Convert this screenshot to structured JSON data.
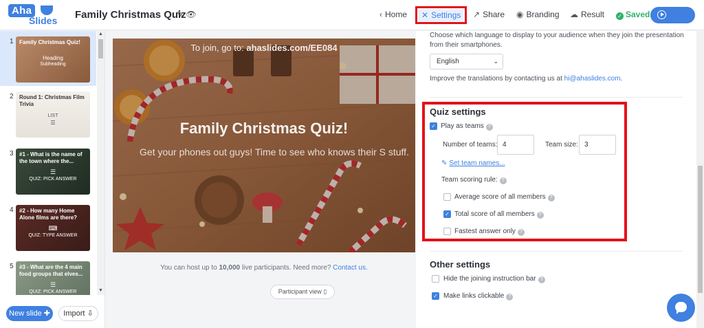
{
  "logo": {
    "top": "Aha",
    "bottom": "Slides"
  },
  "header": {
    "title": "Family Christmas Quiz"
  },
  "nav": {
    "home": "Home",
    "settings": "Settings",
    "share": "Share",
    "branding": "Branding",
    "result": "Result",
    "saved": "Saved",
    "present": "Present"
  },
  "slides": [
    {
      "num": "1",
      "title": "Family Christmas Quiz!",
      "heading": "Heading",
      "subheading": "Subheading"
    },
    {
      "num": "2",
      "title": "Round 1: Christmas Film Trivia",
      "kind": "LIST"
    },
    {
      "num": "3",
      "title": "#1 - What is the name of the town where the...",
      "kind": "QUIZ: PICK ANSWER"
    },
    {
      "num": "4",
      "title": "#2 - How many Home Alone films are there?",
      "kind": "QUIZ: TYPE ANSWER"
    },
    {
      "num": "5",
      "title": "#3 - What are the 4 main food groups that elves...",
      "kind": "QUIZ: PICK ANSWER"
    }
  ],
  "sidebar": {
    "new_slide": "New slide",
    "import": "Import"
  },
  "preview": {
    "join_prefix": "To join, go to:",
    "join_url": "ahaslides.com/EE084",
    "title": "Family Christmas Quiz!",
    "subtitle": "Get your phones out guys! Time to see who knows their S stuff.",
    "host_note_a": "You can host up to",
    "host_note_b": "10,000",
    "host_note_c": "live participants. Need more?",
    "contact": "Contact us.",
    "participant_view": "Participant view"
  },
  "settings": {
    "language_desc": "Choose which language to display to your audience when they join the presentation from their smartphones.",
    "language_value": "English",
    "improve_text": "Improve the translations by contacting us at",
    "improve_email": "hi@ahaslides.com",
    "quiz_title": "Quiz settings",
    "play_as_teams": "Play as teams",
    "play_as_teams_checked": true,
    "num_teams_label": "Number of teams:",
    "num_teams": "4",
    "team_size_label": "Team size:",
    "team_size": "3",
    "set_team_names": "Set team names...",
    "scoring_label": "Team scoring rule:",
    "scoring_options": [
      {
        "label": "Average score of all members",
        "checked": false
      },
      {
        "label": "Total score of all members",
        "checked": true
      },
      {
        "label": "Fastest answer only",
        "checked": false
      }
    ],
    "other_title": "Other settings",
    "hide_joining": "Hide the joining instruction bar",
    "hide_joining_checked": false,
    "links_clickable": "Make links clickable",
    "links_clickable_checked": true
  },
  "colors": {
    "accent": "#3f80e0",
    "highlight": "#e3121b",
    "saved": "#2fb36a"
  }
}
